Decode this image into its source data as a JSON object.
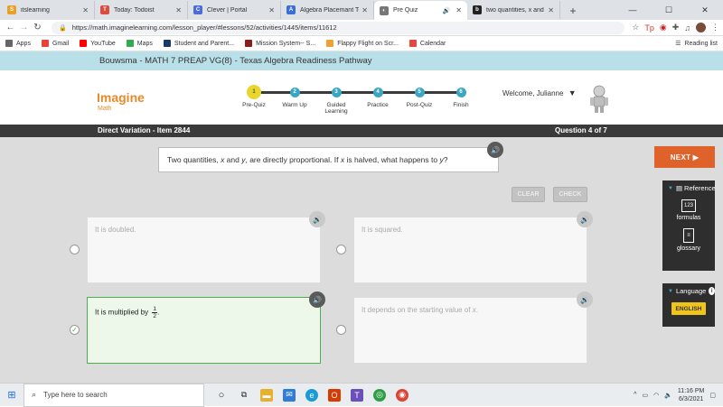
{
  "browser": {
    "tabs": [
      {
        "label": "itslearning",
        "color": "#e8a02a",
        "glyph": "S"
      },
      {
        "label": "Today: Todoist",
        "color": "#db4c3f",
        "glyph": "T"
      },
      {
        "label": "Clever | Portal",
        "color": "#4b6cd9",
        "glyph": "C"
      },
      {
        "label": "Algebra Placemant Te",
        "color": "#3a6fd8",
        "glyph": "A"
      },
      {
        "label": "Pre Quiz",
        "color": "#777777",
        "glyph": "◐",
        "active": true,
        "audio": "🔊"
      },
      {
        "label": "two quantities, x and",
        "color": "#222222",
        "glyph": "b"
      }
    ],
    "url": "https://math.imaginelearning.com/lesson_player/#lessons/52/activities/1445/items/11612",
    "bookmarks": [
      {
        "label": "Apps",
        "color": "#666666"
      },
      {
        "label": "Gmail",
        "color": "#ea4335"
      },
      {
        "label": "YouTube",
        "color": "#ff0000"
      },
      {
        "label": "Maps",
        "color": "#34a853"
      },
      {
        "label": "Student and Parent...",
        "color": "#1a3a6b"
      },
      {
        "label": "Mission System-- S...",
        "color": "#8a1c1c"
      },
      {
        "label": "Flappy Flight on Scr...",
        "color": "#f0a030"
      },
      {
        "label": "Calendar",
        "color": "#e8453c"
      }
    ],
    "reading_list": "Reading list"
  },
  "course_title": "Bouwsma - MATH 7 PREAP VG(8) - Texas Algebra Readiness Pathway",
  "logo": {
    "main": "Imagine",
    "sub": "Math"
  },
  "steps": [
    {
      "num": "1",
      "label": "Pre-Quiz",
      "current": true
    },
    {
      "num": "2",
      "label": "Warm Up"
    },
    {
      "num": "3",
      "label": "Guided Learning"
    },
    {
      "num": "4",
      "label": "Practice"
    },
    {
      "num": "5",
      "label": "Post-Quiz"
    },
    {
      "num": "6",
      "label": "Finish"
    }
  ],
  "welcome": "Welcome, Julianne",
  "item_title": "Direct Variation - Item 2844",
  "question_counter": "Question 4 of 7",
  "question": "Two quantities, x and y, are directly proportional. If x is halved, what happens to y?",
  "buttons": {
    "clear": "CLEAR",
    "check": "CHECK",
    "next": "NEXT ▶"
  },
  "choices": [
    {
      "text": "It is doubled."
    },
    {
      "text": "It is squared."
    },
    {
      "text": "It is multiplied by",
      "fraction_num": "1",
      "fraction_den": "2",
      "suffix": ".",
      "selected": true
    },
    {
      "text": "It depends on the starting value of x."
    }
  ],
  "reference": {
    "title": "Reference",
    "items": [
      "formulas",
      "glossary"
    ]
  },
  "language": {
    "title": "Language",
    "button": "ENGLISH"
  },
  "taskbar": {
    "search_placeholder": "Type here to search",
    "time": "11:16 PM",
    "date": "6/3/2021"
  }
}
